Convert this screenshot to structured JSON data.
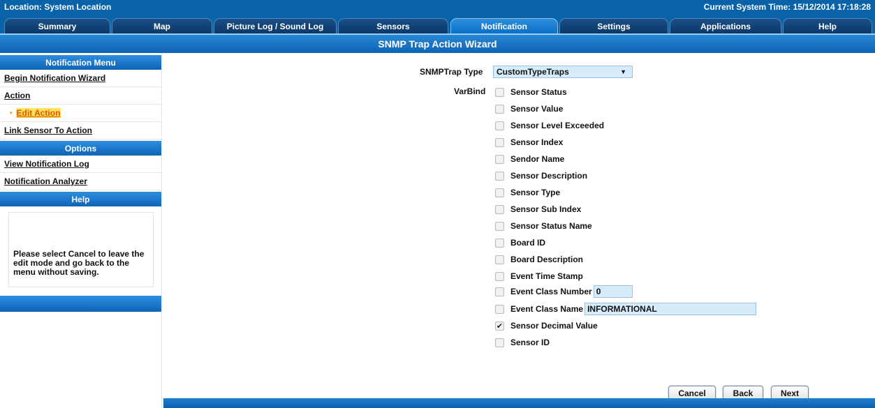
{
  "header": {
    "location": "Location: System Location",
    "system_time": "Current System Time: 15/12/2014 17:18:28"
  },
  "tabs": [
    {
      "label": "Summary"
    },
    {
      "label": "Map"
    },
    {
      "label": "Picture Log / Sound Log"
    },
    {
      "label": "Sensors"
    },
    {
      "label": "Notification",
      "active": true
    },
    {
      "label": "Settings"
    },
    {
      "label": "Applications"
    },
    {
      "label": "Help"
    }
  ],
  "page_title": "SNMP Trap Action Wizard",
  "sidebar": {
    "notification_menu_title": "Notification Menu",
    "items": [
      {
        "label": "Begin Notification Wizard"
      },
      {
        "label": "Action"
      },
      {
        "label": "Edit Action"
      },
      {
        "label": "Link Sensor To Action"
      }
    ],
    "options_title": "Options",
    "options": [
      {
        "label": "View Notification Log"
      },
      {
        "label": "Notification Analyzer"
      }
    ],
    "help_title": "Help",
    "help_text": "Please select Cancel to leave the edit mode and go back to the menu without saving."
  },
  "form": {
    "snmptrap_type_label": "SNMPTrap Type",
    "snmptrap_type_value": "CustomTypeTraps",
    "varbind_label": "VarBind",
    "varbinds": [
      {
        "label": "Sensor Status",
        "checked": false
      },
      {
        "label": "Sensor Value",
        "checked": false
      },
      {
        "label": "Sensor Level Exceeded",
        "checked": false
      },
      {
        "label": "Sensor Index",
        "checked": false
      },
      {
        "label": "Sendor Name",
        "checked": false
      },
      {
        "label": "Sensor Description",
        "checked": false
      },
      {
        "label": "Sensor Type",
        "checked": false
      },
      {
        "label": "Sensor Sub Index",
        "checked": false
      },
      {
        "label": "Sensor Status Name",
        "checked": false
      },
      {
        "label": "Board ID",
        "checked": false
      },
      {
        "label": "Board Description",
        "checked": false
      },
      {
        "label": "Event Time Stamp",
        "checked": false
      },
      {
        "label": "Event Class Number",
        "checked": false,
        "input_value": "0"
      },
      {
        "label": "Event Class Name",
        "checked": false,
        "input_value": "INFORMATIONAL"
      },
      {
        "label": "Sensor Decimal Value",
        "checked": true
      },
      {
        "label": "Sensor ID",
        "checked": false
      }
    ]
  },
  "buttons": {
    "cancel": "Cancel",
    "back": "Back",
    "next": "Next"
  },
  "icons": {
    "select_arrow": "dropdown-arrow-icon",
    "checkmark": "checkmark-icon"
  },
  "colors": {
    "header_blue": "#0a63a8",
    "title_blue": "#1a78c8",
    "input_bg": "#d6ecfb",
    "active_link_highlight": "#ffe25a"
  }
}
